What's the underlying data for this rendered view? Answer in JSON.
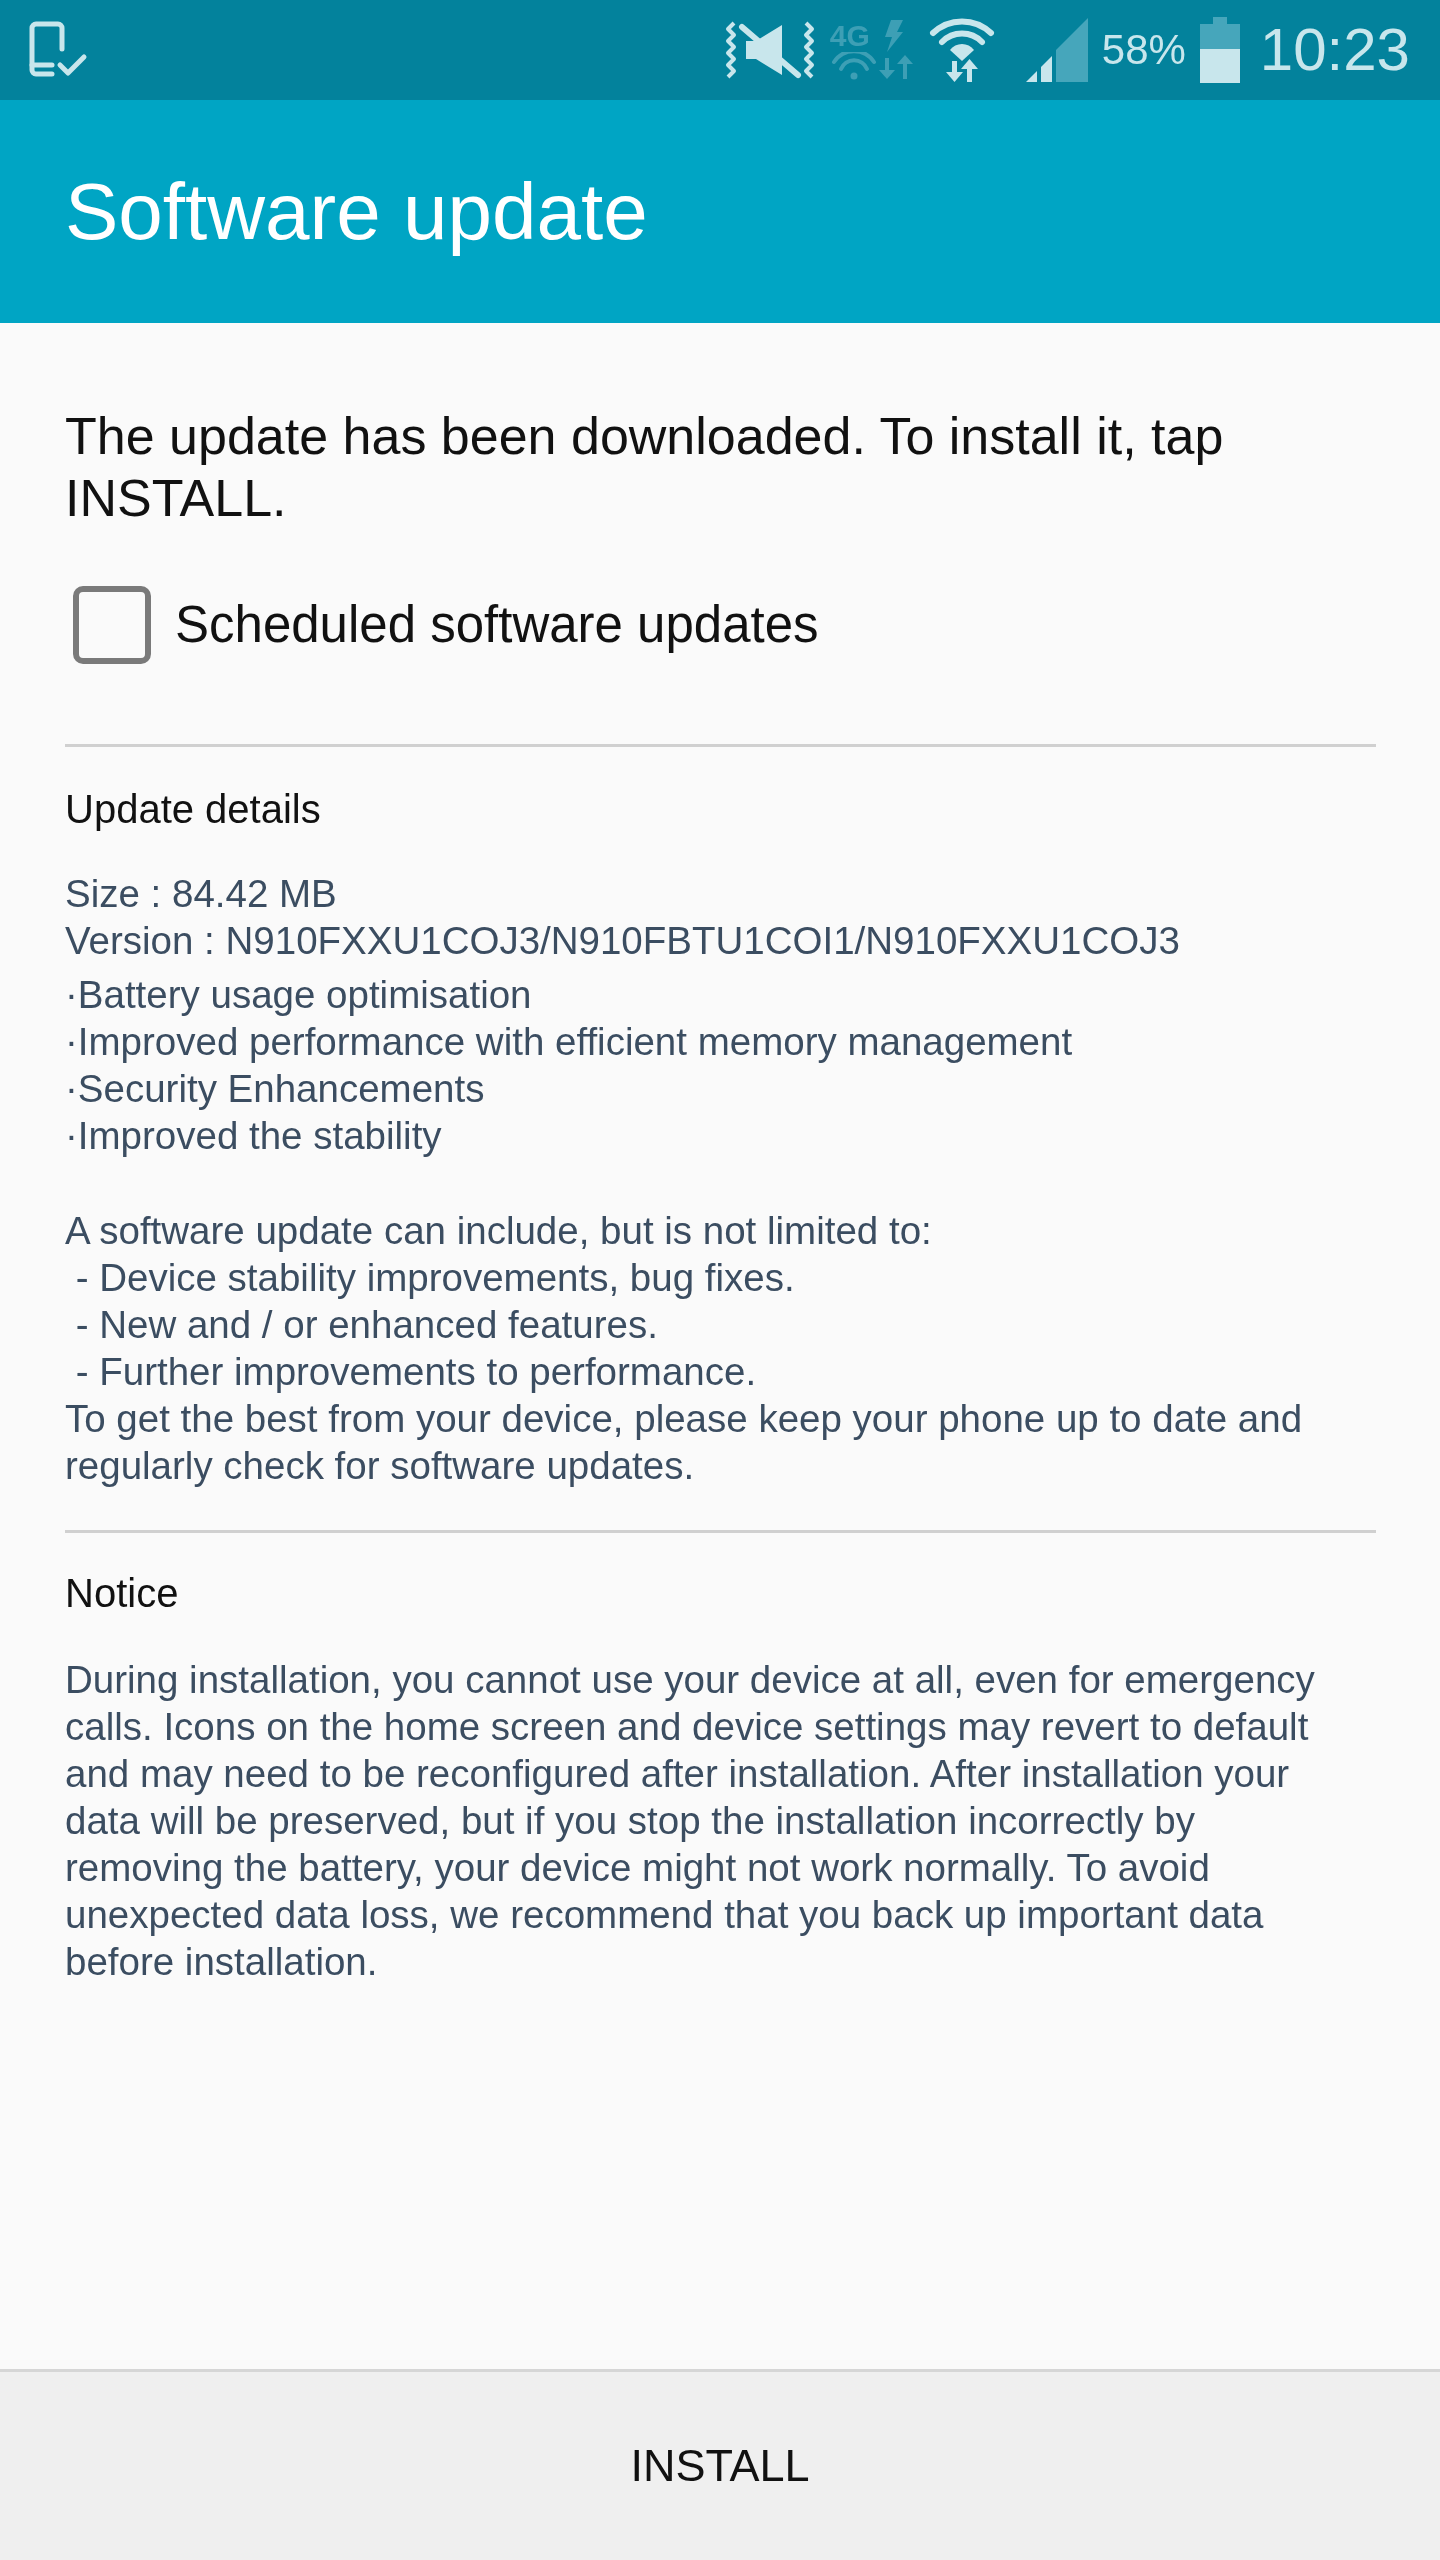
{
  "status_bar": {
    "mobile_data": {
      "label": "4G",
      "active": false
    },
    "battery_percent": "58%",
    "time": "10:23"
  },
  "app_bar": {
    "title": "Software update"
  },
  "message": "The update has been downloaded. To install it, tap INSTALL.",
  "scheduled_updates": {
    "label": "Scheduled software updates",
    "checked": false
  },
  "details": {
    "heading": "Update details",
    "size": "Size : 84.42 MB",
    "version": "Version : N910FXXU1COJ3/N910FBTU1COI1/N910FXXU1COJ3",
    "changes": [
      "·Battery usage optimisation",
      "·Improved performance with efficient memory management",
      "·Security Enhancements",
      "·Improved the stability"
    ],
    "intro": "A software update can include, but is not limited to:",
    "includes": [
      " - Device stability improvements, bug fixes.",
      " - New and / or enhanced features.",
      " - Further improvements to performance."
    ],
    "advice": "To get the best from your device, please keep your phone up to date and regularly check for software updates."
  },
  "notice": {
    "heading": "Notice",
    "text": "During installation, you cannot use your device at all, even for emergency calls. Icons on the home screen and device settings may revert to default and may need to be reconfigured after installation. After installation your data will be preserved, but if you stop the installation incorrectly by removing the battery, your device might not work normally. To avoid unexpected data loss, we recommend that you back up important data before installation."
  },
  "install_button": {
    "label": "INSTALL"
  }
}
